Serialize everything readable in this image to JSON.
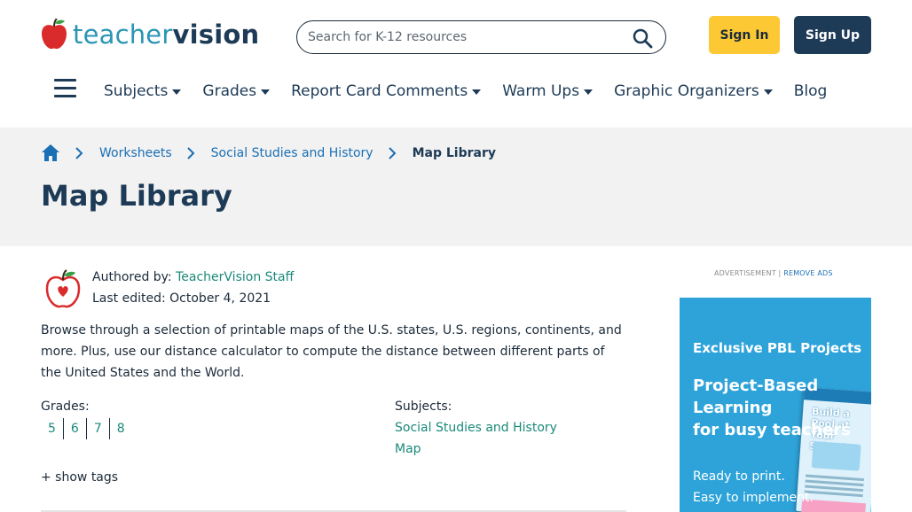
{
  "header": {
    "logo_part1": "teacher",
    "logo_part2": "vision",
    "search_placeholder": "Search for K-12 resources",
    "signin_label": "Sign In",
    "signup_label": "Sign Up",
    "colors": {
      "brand_dark": "#1d3a56",
      "brand_teal": "#2b95b5",
      "signin_bg": "#fcc934"
    }
  },
  "nav": {
    "items": [
      {
        "label": "Subjects",
        "has_dropdown": true
      },
      {
        "label": "Grades",
        "has_dropdown": true
      },
      {
        "label": "Report Card Comments",
        "has_dropdown": true
      },
      {
        "label": "Warm Ups",
        "has_dropdown": true
      },
      {
        "label": "Graphic Organizers",
        "has_dropdown": true
      },
      {
        "label": "Blog",
        "has_dropdown": false
      }
    ]
  },
  "breadcrumb": {
    "items": [
      "Worksheets",
      "Social Studies and History"
    ],
    "current": "Map Library",
    "home_icon": "home-icon"
  },
  "page": {
    "title": "Map Library",
    "authored_prefix": "Authored by: ",
    "author": "TeacherVision Staff",
    "last_edited": "Last edited: October 4, 2021",
    "description": "Browse through a selection of printable maps of the U.S. states, U.S. regions, continents, and more. Plus, use our distance calculator to compute the distance between different parts of the United States and the World.",
    "grades_label": "Grades:",
    "grades": [
      "5",
      "6",
      "7",
      "8"
    ],
    "subjects_label": "Subjects:",
    "subjects": [
      "Social Studies and History",
      "Map"
    ],
    "show_tags": "+ show tags"
  },
  "ad": {
    "label": "ADVERTISEMENT | ",
    "remove": "REMOVE ADS",
    "tag": "Exclusive PBL Projects",
    "headline_line1": "Project-Based",
    "headline_line2": "Learning",
    "headline_line3": "for busy teachers",
    "book_title": "Build a Pool at Your School",
    "sub_line1": "Ready to print.",
    "sub_line2": "Easy to implement."
  }
}
